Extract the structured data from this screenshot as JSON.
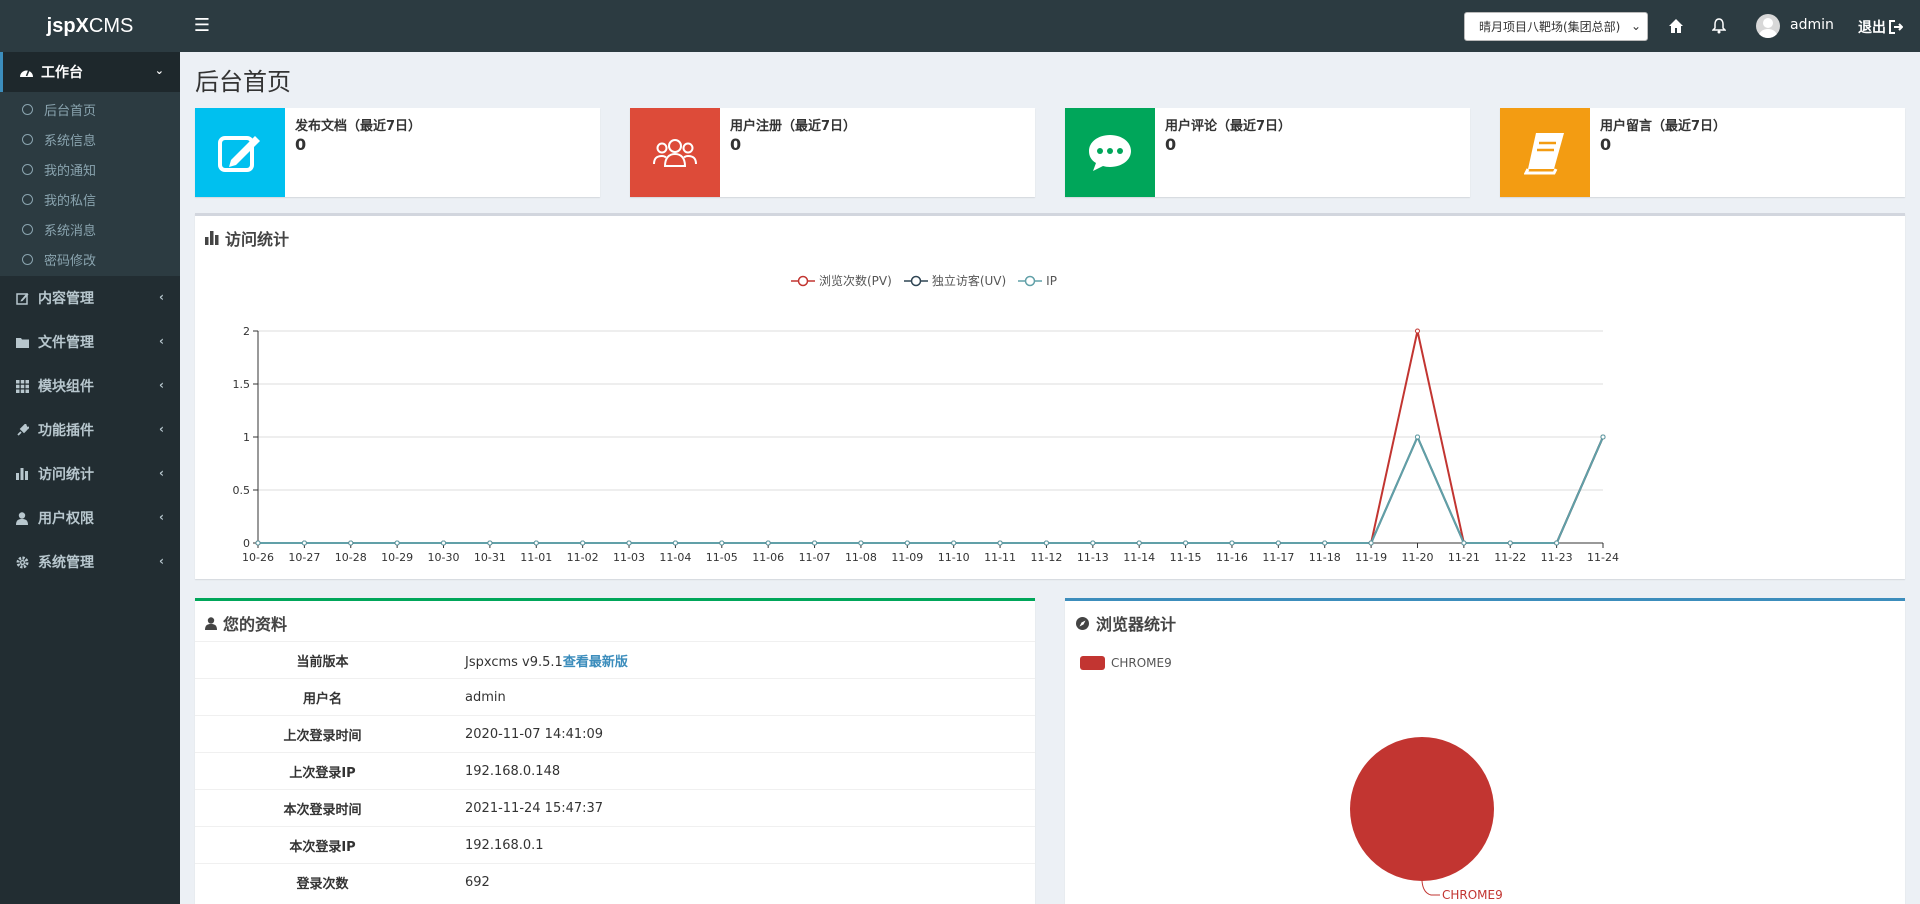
{
  "app": {
    "logo_bold": "jspX",
    "logo_rest": "CMS"
  },
  "topbar": {
    "site_select": "晴月项目八靶场(集团总部)",
    "user": "admin",
    "logout": "退出"
  },
  "sidebar": {
    "workbench": "工作台",
    "sub_items": [
      "后台首页",
      "系统信息",
      "我的通知",
      "我的私信",
      "系统消息",
      "密码修改"
    ],
    "items": [
      {
        "label": "内容管理",
        "icon": "edit-icon"
      },
      {
        "label": "文件管理",
        "icon": "folder-icon"
      },
      {
        "label": "模块组件",
        "icon": "grid-icon"
      },
      {
        "label": "功能插件",
        "icon": "plug-icon"
      },
      {
        "label": "访问统计",
        "icon": "bar-chart-icon"
      },
      {
        "label": "用户权限",
        "icon": "user-icon"
      },
      {
        "label": "系统管理",
        "icon": "gear-icon"
      }
    ]
  },
  "page": {
    "title": "后台首页"
  },
  "info_boxes": [
    {
      "label": "发布文档（最近7日）",
      "value": "0",
      "color": "#00c0ef",
      "icon": "edit-icon"
    },
    {
      "label": "用户注册（最近7日）",
      "value": "0",
      "color": "#dd4b39",
      "icon": "users-icon"
    },
    {
      "label": "用户评论（最近7日）",
      "value": "0",
      "color": "#00a65a",
      "icon": "comment-icon"
    },
    {
      "label": "用户留言（最近7日）",
      "value": "0",
      "color": "#f39c12",
      "icon": "book-icon"
    }
  ],
  "visits": {
    "title": "访问统计",
    "legend": [
      "浏览次数(PV)",
      "独立访客(UV)",
      "IP"
    ]
  },
  "chart_data": {
    "type": "line",
    "x": [
      "10-26",
      "10-27",
      "10-28",
      "10-29",
      "10-30",
      "10-31",
      "11-01",
      "11-02",
      "11-03",
      "11-04",
      "11-05",
      "11-06",
      "11-07",
      "11-08",
      "11-09",
      "11-10",
      "11-11",
      "11-12",
      "11-13",
      "11-14",
      "11-15",
      "11-16",
      "11-17",
      "11-18",
      "11-19",
      "11-20",
      "11-21",
      "11-22",
      "11-23",
      "11-24"
    ],
    "yticks": [
      "0",
      "0.5",
      "1",
      "1.5",
      "2"
    ],
    "ylim": [
      0,
      2
    ],
    "series": [
      {
        "name": "浏览次数(PV)",
        "color": "#c23531",
        "values": [
          0,
          0,
          0,
          0,
          0,
          0,
          0,
          0,
          0,
          0,
          0,
          0,
          0,
          0,
          0,
          0,
          0,
          0,
          0,
          0,
          0,
          0,
          0,
          0,
          0,
          2,
          0,
          0,
          0,
          1
        ]
      },
      {
        "name": "独立访客(UV)",
        "color": "#2f4554",
        "values": [
          0,
          0,
          0,
          0,
          0,
          0,
          0,
          0,
          0,
          0,
          0,
          0,
          0,
          0,
          0,
          0,
          0,
          0,
          0,
          0,
          0,
          0,
          0,
          0,
          0,
          1,
          0,
          0,
          0,
          1
        ]
      },
      {
        "name": "IP",
        "color": "#61a0a8",
        "values": [
          0,
          0,
          0,
          0,
          0,
          0,
          0,
          0,
          0,
          0,
          0,
          0,
          0,
          0,
          0,
          0,
          0,
          0,
          0,
          0,
          0,
          0,
          0,
          0,
          0,
          1,
          0,
          0,
          0,
          1
        ]
      }
    ]
  },
  "profile": {
    "title": "您的资料",
    "rows": [
      {
        "k": "当前版本",
        "v": "Jspxcms v9.5.1",
        "link": "查看最新版"
      },
      {
        "k": "用户名",
        "v": "admin"
      },
      {
        "k": "上次登录时间",
        "v": "2020-11-07 14:41:09"
      },
      {
        "k": "上次登录IP",
        "v": "192.168.0.148"
      },
      {
        "k": "本次登录时间",
        "v": "2021-11-24 15:47:37"
      },
      {
        "k": "本次登录IP",
        "v": "192.168.0.1"
      },
      {
        "k": "登录次数",
        "v": "692"
      }
    ]
  },
  "browser": {
    "title": "浏览器统计",
    "legend": "CHROME9",
    "slice_label": "CHROME9",
    "color": "#c23531"
  }
}
